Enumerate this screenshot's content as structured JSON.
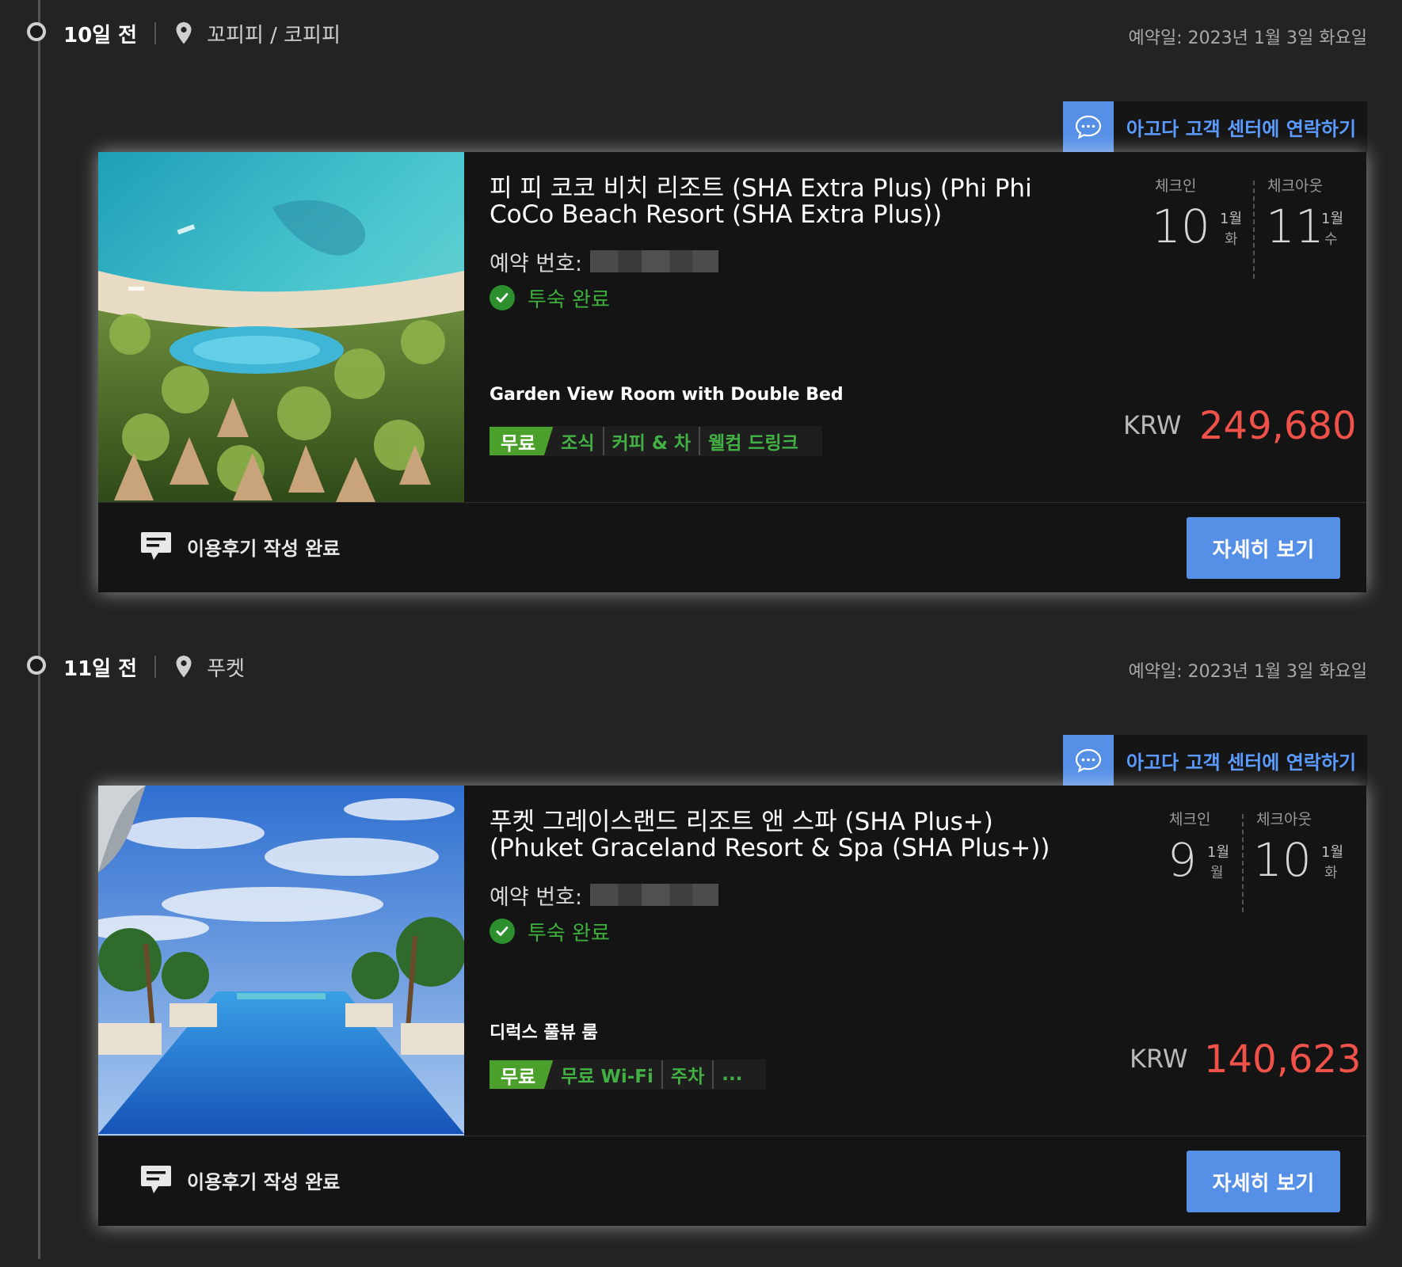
{
  "bookings": [
    {
      "days_ago": "10일 전",
      "location": "꼬피피 / 코피피",
      "booked_on": "예약일: 2023년 1월 3일 화요일",
      "contact_label": "아고다 고객 센터에 연락하기",
      "hotel_name": "피 피 코코 비치 리조트 (SHA Extra Plus) (Phi Phi CoCo Beach Resort (SHA Extra Plus))",
      "booking_no_label": "예약 번호:",
      "status": "투숙 완료",
      "checkin_label": "체크인",
      "checkout_label": "체크아웃",
      "checkin_day": "10",
      "checkin_month": "1월",
      "checkin_weekday": "화",
      "checkout_day": "11",
      "checkout_month": "1월",
      "checkout_weekday": "수",
      "room_type": "Garden View Room with Double Bed",
      "free_badge": "무료",
      "amenities": [
        "조식",
        "커피 & 차",
        "웰컴 드링크"
      ],
      "currency": "KRW",
      "price": "249,680",
      "review_status": "이용후기 작성 완료",
      "detail_button": "자세히 보기"
    },
    {
      "days_ago": "11일 전",
      "location": "푸켓",
      "booked_on": "예약일: 2023년 1월 3일 화요일",
      "contact_label": "아고다 고객 센터에 연락하기",
      "hotel_name": "푸켓 그레이스랜드 리조트 앤 스파 (SHA Plus+) (Phuket Graceland Resort & Spa (SHA Plus+))",
      "booking_no_label": "예약 번호:",
      "status": "투숙 완료",
      "checkin_label": "체크인",
      "checkout_label": "체크아웃",
      "checkin_day": "9",
      "checkin_month": "1월",
      "checkin_weekday": "월",
      "checkout_day": "10",
      "checkout_month": "1월",
      "checkout_weekday": "화",
      "room_type": "디럭스 풀뷰 룸",
      "free_badge": "무료",
      "amenities": [
        "무료 Wi-Fi",
        "주차",
        "..."
      ],
      "currency": "KRW",
      "price": "140,623",
      "review_status": "이용후기 작성 완료",
      "detail_button": "자세히 보기"
    }
  ],
  "colors": {
    "accent": "#5690e6",
    "success": "#3cb13c",
    "price": "#f0524a",
    "background": "#232323",
    "card": "#141414"
  },
  "icons": {
    "location": "map-pin-icon",
    "contact": "chat-bubble-icon",
    "status": "check-circle-icon",
    "review": "review-message-icon"
  }
}
